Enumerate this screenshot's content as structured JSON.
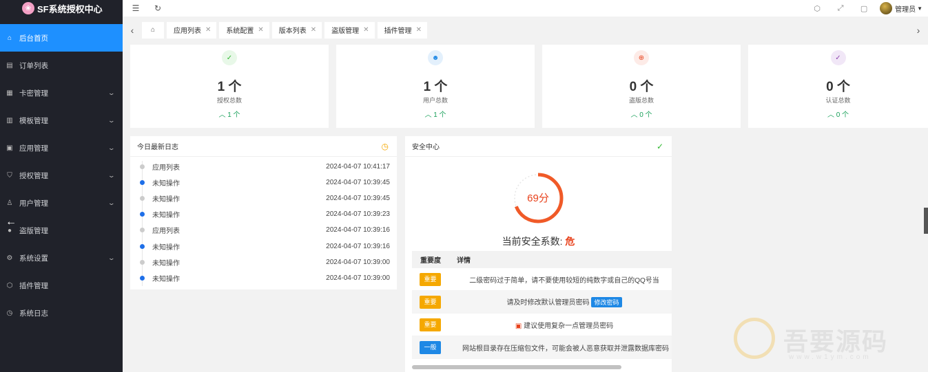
{
  "app": {
    "title": "SF系统授权中心"
  },
  "sidebar": {
    "items": [
      {
        "label": "后台首页",
        "icon": "home-icon",
        "active": true,
        "expandable": false
      },
      {
        "label": "订单列表",
        "icon": "document-icon",
        "active": false,
        "expandable": false
      },
      {
        "label": "卡密管理",
        "icon": "grid-icon",
        "active": false,
        "expandable": true
      },
      {
        "label": "模板管理",
        "icon": "template-icon",
        "active": false,
        "expandable": true
      },
      {
        "label": "应用管理",
        "icon": "apps-icon",
        "active": false,
        "expandable": true
      },
      {
        "label": "授权管理",
        "icon": "shield-icon",
        "active": false,
        "expandable": true
      },
      {
        "label": "用户管理",
        "icon": "user-icon",
        "active": false,
        "expandable": true
      },
      {
        "label": "盗版管理",
        "icon": "circle-icon",
        "active": false,
        "expandable": false
      },
      {
        "label": "系统设置",
        "icon": "gear-icon",
        "active": false,
        "expandable": true
      },
      {
        "label": "插件管理",
        "icon": "cube-icon",
        "active": false,
        "expandable": false
      },
      {
        "label": "系统日志",
        "icon": "clock-icon",
        "active": false,
        "expandable": false
      }
    ]
  },
  "header": {
    "user_name": "管理员",
    "icons": [
      "tag-icon",
      "fullscreen-icon",
      "lock-icon"
    ]
  },
  "tabs": [
    {
      "label": "应用列表"
    },
    {
      "label": "系统配置"
    },
    {
      "label": "版本列表"
    },
    {
      "label": "盗版管理"
    },
    {
      "label": "插件管理"
    }
  ],
  "stats": [
    {
      "value": "1 个",
      "label": "授权总数",
      "trend": "1 个",
      "icon": "shield-check-icon",
      "icon_color": "#2eb82e",
      "icon_bg": "#e8f8e8"
    },
    {
      "value": "1 个",
      "label": "用户总数",
      "trend": "1 个",
      "icon": "users-icon",
      "icon_color": "#1e88e5",
      "icon_bg": "#e3f0fc"
    },
    {
      "value": "0 个",
      "label": "盗版总数",
      "trend": "0 个",
      "icon": "globe-icon",
      "icon_color": "#e8421c",
      "icon_bg": "#fdebe7"
    },
    {
      "value": "0 个",
      "label": "认证总数",
      "trend": "0 个",
      "icon": "check-circle-icon",
      "icon_color": "#8e44ad",
      "icon_bg": "#f1e7f7"
    }
  ],
  "log": {
    "title": "今日最新日志",
    "entries": [
      {
        "name": "应用列表",
        "time": "2024-04-07 10:41:17",
        "highlight": false
      },
      {
        "name": "未知操作",
        "time": "2024-04-07 10:39:45",
        "highlight": true
      },
      {
        "name": "未知操作",
        "time": "2024-04-07 10:39:45",
        "highlight": false
      },
      {
        "name": "未知操作",
        "time": "2024-04-07 10:39:23",
        "highlight": true
      },
      {
        "name": "应用列表",
        "time": "2024-04-07 10:39:16",
        "highlight": false
      },
      {
        "name": "未知操作",
        "time": "2024-04-07 10:39:16",
        "highlight": true
      },
      {
        "name": "未知操作",
        "time": "2024-04-07 10:39:00",
        "highlight": false
      },
      {
        "name": "未知操作",
        "time": "2024-04-07 10:39:00",
        "highlight": true
      }
    ]
  },
  "security": {
    "title": "安全中心",
    "score": 69,
    "score_text": "69分",
    "label": "当前安全系数:",
    "level": "危",
    "columns": {
      "severity": "重要度",
      "details": "详情"
    },
    "rows": [
      {
        "severity": "重要",
        "severity_color": "#f5a800",
        "detail": "二级密码过于简单，请不要使用较短的纯数字或自己的QQ号当",
        "action": ""
      },
      {
        "severity": "重要",
        "severity_color": "#f5a800",
        "detail": "请及时修改默认管理员密码",
        "action": "修改密码"
      },
      {
        "severity": "重要",
        "severity_color": "#f5a800",
        "detail": "建议使用复杂一点管理员密码",
        "action": ""
      },
      {
        "severity": "一般",
        "severity_color": "#1e88e5",
        "detail": "网站根目录存在压缩包文件，可能会被人恶意获取并泄露数据库密码",
        "action": ""
      }
    ]
  },
  "watermark": {
    "text": "吾要源码",
    "url": "www.w1ym.com"
  }
}
